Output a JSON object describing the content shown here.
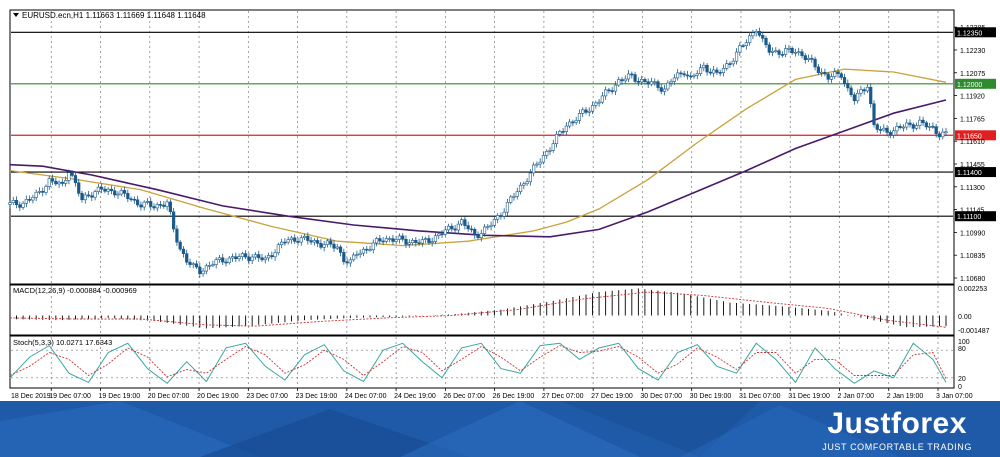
{
  "colors": {
    "background": "#ffffff",
    "grid": "#7a7a7a",
    "price_line": "#000000",
    "level_green": "#2e8b2e",
    "level_red": "#e02020",
    "level_black": "#000000",
    "ma_fast": "#c9a23c",
    "ma_slow": "#4a1a6a",
    "candle": "#1a5a8a",
    "macd_hist": "#000000",
    "macd_signal": "#cc3333",
    "stoch_main": "#3aa7a0",
    "stoch_signal": "#cc3333",
    "banner": "#1f5aa8"
  },
  "header": {
    "menu_icon": "triangle-down-icon",
    "symbol_text": "EURUSD.ecn,H1  1.11663 1.11669 1.11648 1.11648"
  },
  "price_axis": {
    "labels": [
      "1.12385",
      "1.12230",
      "1.12075",
      "1.11920",
      "1.11765",
      "1.11610",
      "1.11455",
      "1.11300",
      "1.11145",
      "1.10990",
      "1.10835",
      "1.10680"
    ]
  },
  "levels": [
    {
      "name": "resistance-2",
      "price": 1.1235,
      "label": "1.12350",
      "color": "#000000",
      "label_bg": "#000000"
    },
    {
      "name": "resistance-1",
      "price": 1.12,
      "label": "1.12000",
      "color": "#2e8b2e",
      "label_bg": "#2e8b2e"
    },
    {
      "name": "current",
      "price": 1.1165,
      "label": "1.11650",
      "color": "#e02020",
      "label_bg": "#e02020"
    },
    {
      "name": "support-1",
      "price": 1.114,
      "label": "1.11400",
      "color": "#000000",
      "label_bg": "#000000"
    },
    {
      "name": "support-2",
      "price": 1.111,
      "label": "1.11100",
      "color": "#000000",
      "label_bg": "#000000"
    }
  ],
  "time_axis": {
    "labels": [
      "18 Dec 2019",
      "19 Dec 07:00",
      "19 Dec 19:00",
      "20 Dec 07:00",
      "20 Dec 19:00",
      "23 Dec 07:00",
      "23 Dec 19:00",
      "24 Dec 07:00",
      "24 Dec 19:00",
      "26 Dec 07:00",
      "26 Dec 19:00",
      "27 Dec 07:00",
      "27 Dec 19:00",
      "30 Dec 07:00",
      "30 Dec 19:00",
      "31 Dec 07:00",
      "31 Dec 19:00",
      "2 Jan 07:00",
      "2 Jan 19:00",
      "3 Jan 07:00"
    ]
  },
  "macd": {
    "title": "MACD(12,26,9) -0.000884 -0.000969",
    "axis_labels": [
      "0.002253",
      "0.00",
      "-0.001487"
    ]
  },
  "stoch": {
    "title": "Stoch(5,3,3) 10.0271 17.6343",
    "axis_labels": [
      "100",
      "80",
      "20",
      "0"
    ]
  },
  "chart_data": {
    "type": "candlestick",
    "symbol": "EURUSD.ecn",
    "timeframe": "H1",
    "ohlc_last": {
      "open": 1.11663,
      "high": 1.11669,
      "low": 1.11648,
      "close": 1.11648
    },
    "ylim": [
      1.1068,
      1.1242
    ],
    "close_path": [
      {
        "t": 0,
        "p": 1.1118
      },
      {
        "t": 4,
        "p": 1.1119
      },
      {
        "t": 8,
        "p": 1.1124
      },
      {
        "t": 12,
        "p": 1.1134
      },
      {
        "t": 16,
        "p": 1.1131
      },
      {
        "t": 18,
        "p": 1.1142
      },
      {
        "t": 20,
        "p": 1.1131
      },
      {
        "t": 22,
        "p": 1.1121
      },
      {
        "t": 24,
        "p": 1.1125
      },
      {
        "t": 28,
        "p": 1.1128
      },
      {
        "t": 32,
        "p": 1.1127
      },
      {
        "t": 36,
        "p": 1.1123
      },
      {
        "t": 40,
        "p": 1.1118
      },
      {
        "t": 44,
        "p": 1.1117
      },
      {
        "t": 48,
        "p": 1.1119
      },
      {
        "t": 50,
        "p": 1.1101
      },
      {
        "t": 52,
        "p": 1.1088
      },
      {
        "t": 54,
        "p": 1.108
      },
      {
        "t": 56,
        "p": 1.1075
      },
      {
        "t": 58,
        "p": 1.1073
      },
      {
        "t": 62,
        "p": 1.1078
      },
      {
        "t": 66,
        "p": 1.1081
      },
      {
        "t": 70,
        "p": 1.1082
      },
      {
        "t": 74,
        "p": 1.1083
      },
      {
        "t": 78,
        "p": 1.108
      },
      {
        "t": 80,
        "p": 1.1085
      },
      {
        "t": 84,
        "p": 1.1093
      },
      {
        "t": 88,
        "p": 1.1095
      },
      {
        "t": 92,
        "p": 1.1093
      },
      {
        "t": 96,
        "p": 1.1091
      },
      {
        "t": 100,
        "p": 1.1089
      },
      {
        "t": 102,
        "p": 1.1081
      },
      {
        "t": 104,
        "p": 1.1078
      },
      {
        "t": 106,
        "p": 1.1085
      },
      {
        "t": 110,
        "p": 1.1089
      },
      {
        "t": 114,
        "p": 1.1095
      },
      {
        "t": 118,
        "p": 1.1094
      },
      {
        "t": 122,
        "p": 1.1093
      },
      {
        "t": 126,
        "p": 1.1092
      },
      {
        "t": 130,
        "p": 1.1096
      },
      {
        "t": 134,
        "p": 1.1101
      },
      {
        "t": 138,
        "p": 1.1106
      },
      {
        "t": 142,
        "p": 1.1097
      },
      {
        "t": 146,
        "p": 1.1102
      },
      {
        "t": 150,
        "p": 1.1112
      },
      {
        "t": 154,
        "p": 1.1124
      },
      {
        "t": 158,
        "p": 1.1136
      },
      {
        "t": 162,
        "p": 1.1148
      },
      {
        "t": 166,
        "p": 1.116
      },
      {
        "t": 170,
        "p": 1.1172
      },
      {
        "t": 174,
        "p": 1.1178
      },
      {
        "t": 178,
        "p": 1.1185
      },
      {
        "t": 182,
        "p": 1.1193
      },
      {
        "t": 186,
        "p": 1.1202
      },
      {
        "t": 190,
        "p": 1.1205
      },
      {
        "t": 194,
        "p": 1.1201
      },
      {
        "t": 198,
        "p": 1.1199
      },
      {
        "t": 200,
        "p": 1.1196
      },
      {
        "t": 202,
        "p": 1.1202
      },
      {
        "t": 206,
        "p": 1.1209
      },
      {
        "t": 208,
        "p": 1.1203
      },
      {
        "t": 212,
        "p": 1.1212
      },
      {
        "t": 216,
        "p": 1.1206
      },
      {
        "t": 220,
        "p": 1.1215
      },
      {
        "t": 224,
        "p": 1.1226
      },
      {
        "t": 228,
        "p": 1.1238
      },
      {
        "t": 230,
        "p": 1.1228
      },
      {
        "t": 232,
        "p": 1.1223
      },
      {
        "t": 236,
        "p": 1.1221
      },
      {
        "t": 240,
        "p": 1.1223
      },
      {
        "t": 244,
        "p": 1.1216
      },
      {
        "t": 248,
        "p": 1.1208
      },
      {
        "t": 250,
        "p": 1.1204
      },
      {
        "t": 254,
        "p": 1.1207
      },
      {
        "t": 256,
        "p": 1.1196
      },
      {
        "t": 258,
        "p": 1.1189
      },
      {
        "t": 262,
        "p": 1.12
      },
      {
        "t": 264,
        "p": 1.1171
      },
      {
        "t": 266,
        "p": 1.1168
      },
      {
        "t": 270,
        "p": 1.1168
      },
      {
        "t": 274,
        "p": 1.1172
      },
      {
        "t": 278,
        "p": 1.1173
      },
      {
        "t": 282,
        "p": 1.117
      },
      {
        "t": 284,
        "p": 1.1166
      },
      {
        "t": 286,
        "p": 1.1165
      }
    ],
    "ma_fast_path": [
      {
        "t": 0,
        "p": 1.1141
      },
      {
        "t": 20,
        "p": 1.1135
      },
      {
        "t": 40,
        "p": 1.1128
      },
      {
        "t": 60,
        "p": 1.1115
      },
      {
        "t": 80,
        "p": 1.1103
      },
      {
        "t": 100,
        "p": 1.1093
      },
      {
        "t": 120,
        "p": 1.109
      },
      {
        "t": 140,
        "p": 1.1093
      },
      {
        "t": 160,
        "p": 1.11
      },
      {
        "t": 170,
        "p": 1.1106
      },
      {
        "t": 180,
        "p": 1.1115
      },
      {
        "t": 195,
        "p": 1.1135
      },
      {
        "t": 210,
        "p": 1.116
      },
      {
        "t": 225,
        "p": 1.1183
      },
      {
        "t": 240,
        "p": 1.1203
      },
      {
        "t": 255,
        "p": 1.121
      },
      {
        "t": 270,
        "p": 1.1208
      },
      {
        "t": 286,
        "p": 1.1201
      }
    ],
    "ma_slow_path": [
      {
        "t": 0,
        "p": 1.1145
      },
      {
        "t": 10,
        "p": 1.1144
      },
      {
        "t": 25,
        "p": 1.1138
      },
      {
        "t": 45,
        "p": 1.1128
      },
      {
        "t": 65,
        "p": 1.1117
      },
      {
        "t": 85,
        "p": 1.111
      },
      {
        "t": 105,
        "p": 1.1104
      },
      {
        "t": 125,
        "p": 1.11
      },
      {
        "t": 145,
        "p": 1.1097
      },
      {
        "t": 165,
        "p": 1.1096
      },
      {
        "t": 180,
        "p": 1.1101
      },
      {
        "t": 195,
        "p": 1.1113
      },
      {
        "t": 210,
        "p": 1.1127
      },
      {
        "t": 225,
        "p": 1.1141
      },
      {
        "t": 240,
        "p": 1.1156
      },
      {
        "t": 255,
        "p": 1.1168
      },
      {
        "t": 270,
        "p": 1.118
      },
      {
        "t": 286,
        "p": 1.1189
      }
    ],
    "macd_range": [
      -0.001487,
      0.002253
    ],
    "macd_hist_path": [
      {
        "t": 0,
        "p": -0.0003
      },
      {
        "t": 15,
        "p": -0.0004
      },
      {
        "t": 30,
        "p": -0.0002
      },
      {
        "t": 45,
        "p": -0.0005
      },
      {
        "t": 60,
        "p": -0.0011
      },
      {
        "t": 72,
        "p": -0.0009
      },
      {
        "t": 90,
        "p": -0.0004
      },
      {
        "t": 105,
        "p": -0.0002
      },
      {
        "t": 120,
        "p": -0.0001
      },
      {
        "t": 135,
        "p": 0.0001
      },
      {
        "t": 150,
        "p": 0.0005
      },
      {
        "t": 165,
        "p": 0.0012
      },
      {
        "t": 180,
        "p": 0.002
      },
      {
        "t": 192,
        "p": 0.0023
      },
      {
        "t": 205,
        "p": 0.0019
      },
      {
        "t": 220,
        "p": 0.0011
      },
      {
        "t": 235,
        "p": 0.0008
      },
      {
        "t": 250,
        "p": 0.0004
      },
      {
        "t": 262,
        "p": -0.0003
      },
      {
        "t": 274,
        "p": -0.001
      },
      {
        "t": 286,
        "p": -0.0009
      }
    ],
    "macd_signal_path": [
      {
        "t": 0,
        "p": -0.0002
      },
      {
        "t": 20,
        "p": -0.0003
      },
      {
        "t": 40,
        "p": -0.0003
      },
      {
        "t": 60,
        "p": -0.0008
      },
      {
        "t": 75,
        "p": -0.0009
      },
      {
        "t": 95,
        "p": -0.0005
      },
      {
        "t": 115,
        "p": -0.0002
      },
      {
        "t": 135,
        "p": 0.0
      },
      {
        "t": 155,
        "p": 0.0005
      },
      {
        "t": 175,
        "p": 0.0014
      },
      {
        "t": 195,
        "p": 0.002
      },
      {
        "t": 212,
        "p": 0.0017
      },
      {
        "t": 232,
        "p": 0.0011
      },
      {
        "t": 250,
        "p": 0.0006
      },
      {
        "t": 268,
        "p": -0.0004
      },
      {
        "t": 286,
        "p": -0.001
      }
    ],
    "stoch_main_path": [
      {
        "t": 0,
        "p": 20
      },
      {
        "t": 6,
        "p": 65
      },
      {
        "t": 12,
        "p": 90
      },
      {
        "t": 18,
        "p": 30
      },
      {
        "t": 24,
        "p": 10
      },
      {
        "t": 30,
        "p": 75
      },
      {
        "t": 36,
        "p": 95
      },
      {
        "t": 42,
        "p": 40
      },
      {
        "t": 48,
        "p": 8
      },
      {
        "t": 54,
        "p": 55
      },
      {
        "t": 60,
        "p": 12
      },
      {
        "t": 66,
        "p": 85
      },
      {
        "t": 72,
        "p": 95
      },
      {
        "t": 78,
        "p": 45
      },
      {
        "t": 84,
        "p": 15
      },
      {
        "t": 90,
        "p": 70
      },
      {
        "t": 96,
        "p": 92
      },
      {
        "t": 102,
        "p": 35
      },
      {
        "t": 108,
        "p": 12
      },
      {
        "t": 114,
        "p": 80
      },
      {
        "t": 120,
        "p": 95
      },
      {
        "t": 126,
        "p": 55
      },
      {
        "t": 132,
        "p": 20
      },
      {
        "t": 138,
        "p": 85
      },
      {
        "t": 144,
        "p": 95
      },
      {
        "t": 150,
        "p": 40
      },
      {
        "t": 156,
        "p": 30
      },
      {
        "t": 162,
        "p": 90
      },
      {
        "t": 168,
        "p": 95
      },
      {
        "t": 174,
        "p": 60
      },
      {
        "t": 180,
        "p": 85
      },
      {
        "t": 186,
        "p": 95
      },
      {
        "t": 192,
        "p": 40
      },
      {
        "t": 198,
        "p": 15
      },
      {
        "t": 204,
        "p": 75
      },
      {
        "t": 210,
        "p": 92
      },
      {
        "t": 216,
        "p": 45
      },
      {
        "t": 222,
        "p": 30
      },
      {
        "t": 228,
        "p": 95
      },
      {
        "t": 234,
        "p": 60
      },
      {
        "t": 240,
        "p": 10
      },
      {
        "t": 246,
        "p": 85
      },
      {
        "t": 252,
        "p": 40
      },
      {
        "t": 258,
        "p": 8
      },
      {
        "t": 264,
        "p": 35
      },
      {
        "t": 270,
        "p": 20
      },
      {
        "t": 276,
        "p": 95
      },
      {
        "t": 282,
        "p": 60
      },
      {
        "t": 286,
        "p": 10
      }
    ],
    "stoch_signal_path": [
      {
        "t": 0,
        "p": 25
      },
      {
        "t": 6,
        "p": 45
      },
      {
        "t": 12,
        "p": 75
      },
      {
        "t": 18,
        "p": 60
      },
      {
        "t": 24,
        "p": 25
      },
      {
        "t": 30,
        "p": 50
      },
      {
        "t": 36,
        "p": 85
      },
      {
        "t": 42,
        "p": 65
      },
      {
        "t": 48,
        "p": 22
      },
      {
        "t": 54,
        "p": 38
      },
      {
        "t": 60,
        "p": 30
      },
      {
        "t": 66,
        "p": 60
      },
      {
        "t": 72,
        "p": 88
      },
      {
        "t": 78,
        "p": 70
      },
      {
        "t": 84,
        "p": 30
      },
      {
        "t": 90,
        "p": 48
      },
      {
        "t": 96,
        "p": 80
      },
      {
        "t": 102,
        "p": 60
      },
      {
        "t": 108,
        "p": 25
      },
      {
        "t": 114,
        "p": 55
      },
      {
        "t": 120,
        "p": 88
      },
      {
        "t": 126,
        "p": 75
      },
      {
        "t": 132,
        "p": 35
      },
      {
        "t": 138,
        "p": 60
      },
      {
        "t": 144,
        "p": 88
      },
      {
        "t": 150,
        "p": 65
      },
      {
        "t": 156,
        "p": 35
      },
      {
        "t": 162,
        "p": 65
      },
      {
        "t": 168,
        "p": 90
      },
      {
        "t": 174,
        "p": 75
      },
      {
        "t": 180,
        "p": 78
      },
      {
        "t": 186,
        "p": 88
      },
      {
        "t": 192,
        "p": 65
      },
      {
        "t": 198,
        "p": 30
      },
      {
        "t": 204,
        "p": 50
      },
      {
        "t": 210,
        "p": 85
      },
      {
        "t": 216,
        "p": 65
      },
      {
        "t": 222,
        "p": 38
      },
      {
        "t": 228,
        "p": 75
      },
      {
        "t": 234,
        "p": 75
      },
      {
        "t": 240,
        "p": 30
      },
      {
        "t": 246,
        "p": 60
      },
      {
        "t": 252,
        "p": 60
      },
      {
        "t": 258,
        "p": 25
      },
      {
        "t": 264,
        "p": 25
      },
      {
        "t": 270,
        "p": 25
      },
      {
        "t": 276,
        "p": 70
      },
      {
        "t": 282,
        "p": 75
      },
      {
        "t": 286,
        "p": 18
      }
    ]
  },
  "banner": {
    "brand_name": "Justforex",
    "tagline": "JUST COMFORTABLE TRADING"
  }
}
